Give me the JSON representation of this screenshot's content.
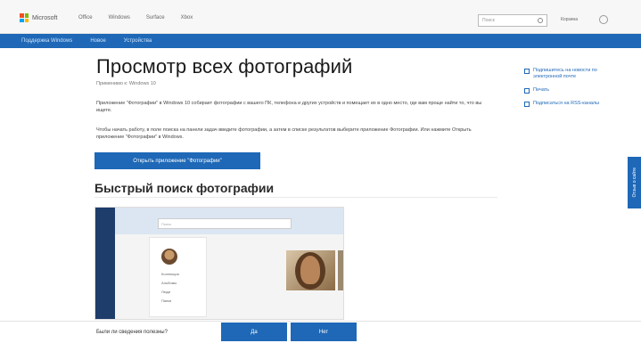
{
  "header": {
    "logo_text": "Microsoft",
    "nav": [
      "Office",
      "Windows",
      "Surface",
      "Xbox"
    ],
    "search_placeholder": "Поиск",
    "cart_label": "Корзина"
  },
  "subnav": {
    "items": [
      "Поддержка Windows",
      "Новое",
      "Устройства"
    ]
  },
  "article": {
    "title": "Просмотр всех фотографий",
    "applies_to": "Применимо к: Windows 10",
    "para1": "Приложение \"Фотографии\" в Windows 10 собирает фотографии с вашего ПК, телефона и других устройств и помещает их в одно место, где вам проще найти то, что вы ищете.",
    "para2": "Чтобы начать работу, в поле поиска на панели задач введите фотографии, а затем в списке результатов выберите приложение Фотографии. Или нажмите Открыть приложение \"Фотографии\" в Windows.",
    "open_button": "Открыть приложение \"Фотографии\"",
    "section_title": "Быстрый поиск фотографии"
  },
  "screenshot": {
    "search_text": "Поиск",
    "menu": [
      "Коллекция",
      "Альбомы",
      "Люди",
      "Папки"
    ]
  },
  "sidebar": {
    "links": [
      "Подпишитесь на новости по электронной почте",
      "Печать",
      "Подписаться на RSS-каналы"
    ]
  },
  "feedback": {
    "tab_label": "Отзыв о сайте",
    "question": "Были ли сведения полезны?",
    "yes": "Да",
    "no": "Нет"
  },
  "colors": {
    "accent": "#1e68b7",
    "sidebar_dark": "#1e3d6b"
  }
}
